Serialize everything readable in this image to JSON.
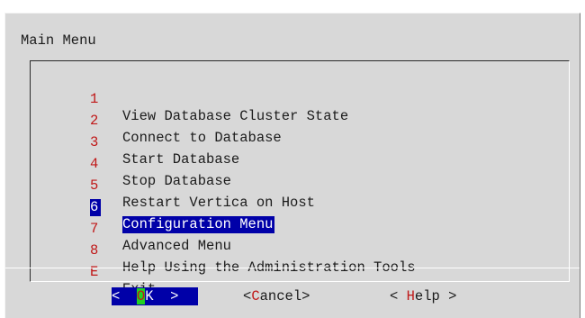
{
  "dialog": {
    "title": "Main Menu"
  },
  "menu": {
    "selected_index": 5,
    "items": [
      {
        "key": "1",
        "label": "View Database Cluster State"
      },
      {
        "key": "2",
        "label": "Connect to Database"
      },
      {
        "key": "3",
        "label": "Start Database"
      },
      {
        "key": "4",
        "label": "Stop Database"
      },
      {
        "key": "5",
        "label": "Restart Vertica on Host"
      },
      {
        "key": "6",
        "label": "Configuration Menu"
      },
      {
        "key": "7",
        "label": "Advanced Menu"
      },
      {
        "key": "8",
        "label": "Help Using the Administration Tools"
      },
      {
        "key": "E",
        "label": "Exit"
      }
    ]
  },
  "buttons": {
    "ok": {
      "left": "<  ",
      "hot": "O",
      "rest": "K  >"
    },
    "cancel": {
      "left": "<",
      "hot": "C",
      "rest": "ancel>"
    },
    "help": {
      "left": "< ",
      "hot": "H",
      "rest": "elp >"
    }
  },
  "colors": {
    "dialog_bg": "#d8d8d8",
    "selection_bg": "#0000a8",
    "selection_fg": "#ffffff",
    "hotkey": "#c01818",
    "ok_hotkey_bg": "#22d022"
  }
}
